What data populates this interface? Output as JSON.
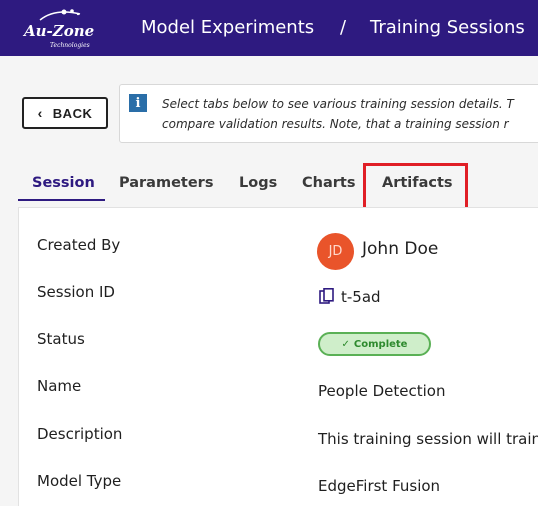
{
  "header": {
    "logo": {
      "brand": "Au-Zone",
      "sub": "Technologies"
    },
    "breadcrumb": [
      "Model Experiments",
      "Training Sessions"
    ],
    "separator": "/"
  },
  "back_button": {
    "label": "BACK",
    "icon": "chevron-left-icon"
  },
  "info": {
    "icon": "info-icon",
    "glyph": "i",
    "line1": "Select tabs below to see various training session details. T",
    "line2": "compare validation results. Note, that a training session r"
  },
  "tabs": [
    {
      "label": "Session",
      "active": true
    },
    {
      "label": "Parameters",
      "active": false
    },
    {
      "label": "Logs",
      "active": false
    },
    {
      "label": "Charts",
      "active": false
    },
    {
      "label": "Artifacts",
      "active": false,
      "highlighted": true
    }
  ],
  "details": {
    "created_by": {
      "label": "Created By",
      "initials": "JD",
      "name": "John Doe"
    },
    "session_id": {
      "label": "Session ID",
      "value": "t-5ad",
      "icon": "copy-icon"
    },
    "status": {
      "label": "Status",
      "value": "Complete",
      "check": "✓"
    },
    "name": {
      "label": "Name",
      "value": "People Detection"
    },
    "description": {
      "label": "Description",
      "value": "This training session will train"
    },
    "model_type": {
      "label": "Model Type",
      "value": "EdgeFirst Fusion"
    }
  },
  "colors": {
    "header_bg": "#2e1a80",
    "active_tab": "#2e1a80",
    "highlight": "#e01f26",
    "status_bg": "#cfeeca",
    "status_text": "#2e8a2e",
    "avatar_bg": "#e9542a"
  }
}
